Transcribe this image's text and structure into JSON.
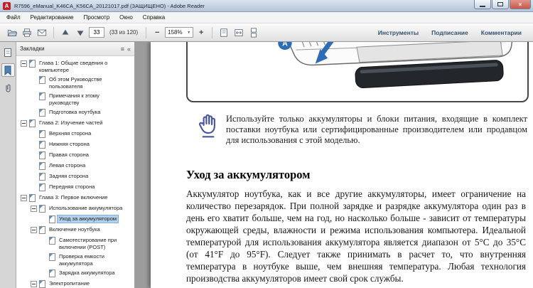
{
  "window": {
    "title": "R7596_eManual_K46CA_K56CA_20121017.pdf (ЗАЩИЩЕНО) - Adobe Reader"
  },
  "menu": {
    "items": [
      {
        "label": "Файл"
      },
      {
        "label": "Редактирование"
      },
      {
        "label": "Просмотр"
      },
      {
        "label": "Окно"
      },
      {
        "label": "Справка"
      }
    ]
  },
  "toolbar": {
    "page_value": "33",
    "page_info": "(33 из 120)",
    "zoom_value": "158%",
    "actions": [
      {
        "label": "Инструменты"
      },
      {
        "label": "Подписание"
      },
      {
        "label": "Комментарии"
      }
    ]
  },
  "icons": {
    "zoom_out": "−",
    "zoom_in": "+",
    "caret": "▼",
    "panel_options": "≡",
    "panel_collapse": "«",
    "close": "×"
  },
  "sidebar": {
    "title": "Закладки",
    "bookmarks": [
      {
        "label": "Глава 1: Общие сведения о компьютере",
        "level": 0,
        "expander": true
      },
      {
        "label": "Об этом Руководстве пользователя",
        "level": 1
      },
      {
        "label": "Примечания к этому руководству",
        "level": 1
      },
      {
        "label": "Подготовка ноутбука",
        "level": 1
      },
      {
        "label": "Глава 2: Изучение частей",
        "level": 0,
        "expander": true
      },
      {
        "label": "Верхняя сторона",
        "level": 1
      },
      {
        "label": "Нижняя сторона",
        "level": 1
      },
      {
        "label": "Правая сторона",
        "level": 1
      },
      {
        "label": "Левая сторона",
        "level": 1
      },
      {
        "label": "Задняя сторона",
        "level": 1
      },
      {
        "label": "Передняя сторона",
        "level": 1
      },
      {
        "label": "Глава 3: Первое включение",
        "level": 0,
        "expander": true
      },
      {
        "label": "Использование аккумулятора",
        "level": 1,
        "expander": true
      },
      {
        "label": "Уход за аккумулятором",
        "level": 2,
        "selected": true
      },
      {
        "label": "Включение ноутбука",
        "level": 1,
        "expander": true
      },
      {
        "label": "Самотестирование при включении (POST)",
        "level": 2
      },
      {
        "label": "Проверка емкости аккумулятора",
        "level": 2
      },
      {
        "label": "Зарядка аккумулятора",
        "level": 2
      },
      {
        "label": "Электропитание",
        "level": 1,
        "expander": true
      }
    ]
  },
  "content": {
    "figure_badge": "A",
    "notice": "Используйте только аккумуляторы и блоки питания, входящие в комплект поставки ноутбука или сертифицированные производителем или продавцом для использования с этой моделью.",
    "heading": "Уход за аккумулятором",
    "paragraph": "Аккумулятор ноутбука, как и все другие аккумуляторы, имеет ограничение на количество перезарядок. При полной зарядке и разрядке аккумулятора один раз в день его хватит больше, чем на год, но насколько больше - зависит от температуры окружающей среды, влажности и режима использования компьютера. Идеальной температурой для использования аккумулятора является диапазон от 5°C до 35°C (от 41°F до 95°F). Следует также принимать в расчет то, что внутренняя температура в ноутбуке выше, чем внешняя температура. Любая технология производства аккумуляторов имеет свой срок службы."
  }
}
